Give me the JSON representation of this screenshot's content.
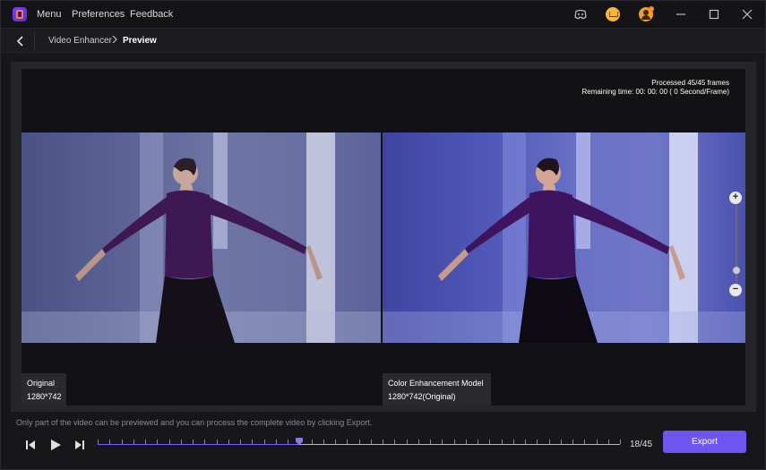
{
  "menu": {
    "items": [
      {
        "label": "Menu"
      },
      {
        "label": "Preferences"
      },
      {
        "label": "Feedback"
      }
    ]
  },
  "breadcrumb": {
    "parent": "Video Enhancer",
    "current": "Preview"
  },
  "processing": {
    "frames": "Processed 45/45 frames",
    "remaining": "Remaining time: 00: 00: 00 ( 0 Second/Frame)"
  },
  "panes": {
    "left": {
      "title": "Original",
      "resolution": "1280*742"
    },
    "right": {
      "title": "Color Enhancement Model",
      "resolution": "1280*742(Original)"
    }
  },
  "footer": {
    "notice": "Only part of the video can be previewed and you can process the complete video by clicking Export.",
    "frame_counter": "18/45",
    "export_label": "Export",
    "current_frame": 18,
    "total_frames": 45
  },
  "colors": {
    "accent": "#6d55f0",
    "background": "#17171a"
  }
}
